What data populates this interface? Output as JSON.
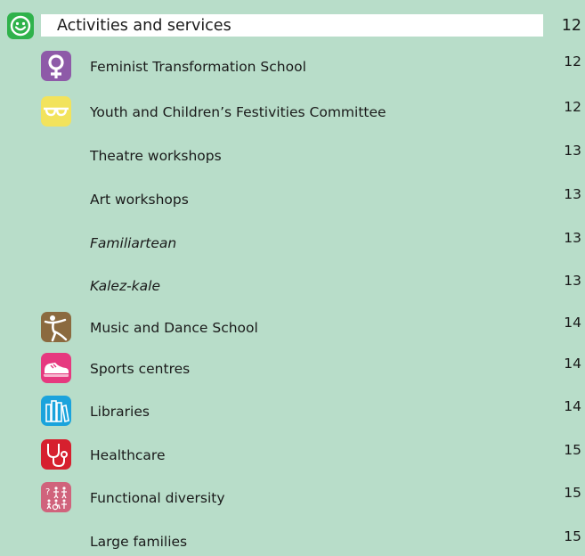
{
  "section": {
    "title": "Activities and services",
    "page": "12",
    "icon": "smiley-icon",
    "color": "#2fb24b"
  },
  "entries": [
    {
      "title": "Feminist Transformation School",
      "page": "12",
      "icon": "venus-icon",
      "color": "#8e5aa8"
    },
    {
      "title": "Youth and Children’s Festivities Committee",
      "page": "12",
      "icon": "glasses-icon",
      "color": "#f2e35c"
    },
    {
      "title": "Theatre workshops",
      "page": "13"
    },
    {
      "title": "Art workshops",
      "page": "13"
    },
    {
      "title": "Familiartean",
      "page": "13"
    },
    {
      "title": "Kalez-kale",
      "page": "13"
    },
    {
      "title": "Music and Dance School",
      "page": "14",
      "icon": "dancer-icon",
      "color": "#8b6a3f"
    },
    {
      "title": "Sports centres",
      "page": "14",
      "icon": "sneaker-icon",
      "color": "#e6397f"
    },
    {
      "title": "Libraries",
      "page": "14",
      "icon": "books-icon",
      "color": "#1aa3dc"
    },
    {
      "title": "Healthcare",
      "page": "15",
      "icon": "stethoscope-icon",
      "color": "#d6202e"
    },
    {
      "title": "Functional diversity",
      "page": "15",
      "icon": "accessibility-icon",
      "color": "#d0637c"
    },
    {
      "title": "Large families",
      "page": "15"
    }
  ]
}
